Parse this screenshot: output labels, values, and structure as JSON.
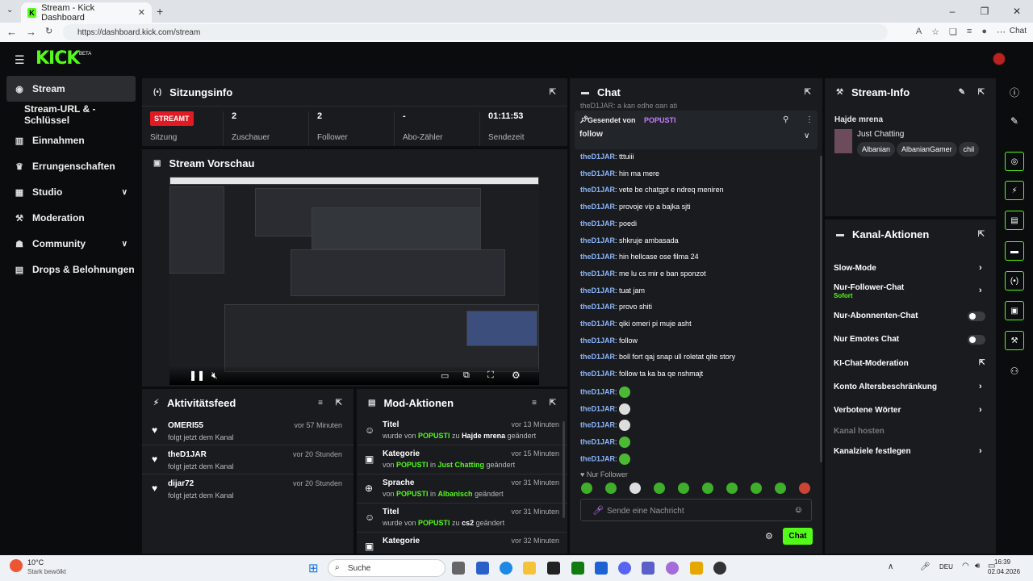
{
  "browser": {
    "tab_title": "Stream - Kick Dashboard",
    "url": "https://dashboard.kick.com/stream",
    "chat_label": "Chat"
  },
  "app": {
    "logo": "KICK",
    "beta": "BETA"
  },
  "sidebar": {
    "items": [
      {
        "label": "Stream",
        "icon": "stream-icon"
      },
      {
        "label": "Stream-URL & -Schlüssel"
      },
      {
        "label": "Einnahmen",
        "icon": "chart-icon"
      },
      {
        "label": "Errungenschaften",
        "icon": "trophy-icon"
      },
      {
        "label": "Studio",
        "icon": "studio-icon"
      },
      {
        "label": "Moderation",
        "icon": "wrench-icon"
      },
      {
        "label": "Community",
        "icon": "community-icon"
      },
      {
        "label": "Drops & Belohnungen",
        "icon": "drops-icon"
      }
    ]
  },
  "session": {
    "title": "Sitzungsinfo",
    "badge": "STREAMT",
    "badge_label": "Sitzung",
    "stats": [
      {
        "value": "2",
        "label": "Zuschauer"
      },
      {
        "value": "2",
        "label": "Follower"
      },
      {
        "value": "-",
        "label": "Abo-Zähler"
      },
      {
        "value": "01:11:53",
        "label": "Sendezeit"
      }
    ]
  },
  "preview": {
    "title": "Stream Vorschau"
  },
  "activity": {
    "title": "Aktivitätsfeed",
    "items": [
      {
        "name": "OMERI55",
        "sub": "folgt jetzt dem Kanal",
        "time": "vor 57 Minuten"
      },
      {
        "name": "theD1JAR",
        "sub": "folgt jetzt dem Kanal",
        "time": "vor 20 Stunden"
      },
      {
        "name": "dijar72",
        "sub": "folgt jetzt dem Kanal",
        "time": "vor 20 Stunden"
      }
    ]
  },
  "mod": {
    "title": "Mod-Aktionen",
    "items": [
      {
        "title": "Titel",
        "time": "vor 13 Minuten",
        "p1": "wurde von ",
        "who": "POPUSTI",
        "p2": " zu ",
        "what": "Hajde mrena",
        "p3": " geändert",
        "what_color": "w"
      },
      {
        "title": "Kategorie",
        "time": "vor 15 Minuten",
        "p1": "von ",
        "who": "POPUSTI",
        "p2": " in ",
        "what": "Just Chatting",
        "p3": " geändert",
        "what_color": "g"
      },
      {
        "title": "Sprache",
        "time": "vor 31 Minuten",
        "p1": "von ",
        "who": "POPUSTI",
        "p2": " in ",
        "what": "Albanisch",
        "p3": " geändert",
        "what_color": "g"
      },
      {
        "title": "Titel",
        "time": "vor 31 Minuten",
        "p1": "wurde von ",
        "who": "POPUSTI",
        "p2": " zu ",
        "what": "cs2",
        "p3": " geändert",
        "what_color": "w"
      },
      {
        "title": "Kategorie",
        "time": "vor 32 Minuten",
        "p1": "",
        "who": "",
        "p2": "",
        "what": "",
        "p3": "",
        "what_color": "w"
      }
    ]
  },
  "chat": {
    "title": "Chat",
    "partial_top": "theD1JAR: a kan edhe qan atj",
    "pinned_by": "Gesendet von",
    "pinned_user": "POPUSTI",
    "pinned_msg": "follow",
    "messages": [
      {
        "user": "theD1JAR",
        "text": "tttuiii"
      },
      {
        "user": "theD1JAR",
        "text": "hin ma mere"
      },
      {
        "user": "theD1JAR",
        "text": "vete be chatgpt e ndreq meniren"
      },
      {
        "user": "theD1JAR",
        "text": "provoje vip a bajka sjti"
      },
      {
        "user": "theD1JAR",
        "text": "poedi"
      },
      {
        "user": "theD1JAR",
        "text": "shkruje ambasada"
      },
      {
        "user": "theD1JAR",
        "text": "hin hellcase ose filma 24"
      },
      {
        "user": "theD1JAR",
        "text": "me lu cs mir e ban sponzot"
      },
      {
        "user": "theD1JAR",
        "text": "tuat jam"
      },
      {
        "user": "theD1JAR",
        "text": "provo shiti"
      },
      {
        "user": "theD1JAR",
        "text": "qiki omeri pi muje asht"
      },
      {
        "user": "theD1JAR",
        "text": "follow"
      },
      {
        "user": "theD1JAR",
        "text": "boll fort qaj snap ull roletat qite story"
      },
      {
        "user": "theD1JAR",
        "text": "follow ta ka ba qe nshmajt"
      },
      {
        "user": "theD1JAR",
        "text": "",
        "emote": "green"
      },
      {
        "user": "theD1JAR",
        "text": "",
        "emote": "gray"
      },
      {
        "user": "theD1JAR",
        "text": "",
        "emote": "gray"
      },
      {
        "user": "theD1JAR",
        "text": "",
        "emote": "green"
      },
      {
        "user": "theD1JAR",
        "text": "",
        "emote": "green"
      }
    ],
    "mode": "Nur Follower",
    "placeholder": "Sende eine Nachricht",
    "send": "Chat"
  },
  "stream_info": {
    "title": "Stream-Info",
    "stream_title": "Hajde mrena",
    "category": "Just Chatting",
    "tags": [
      "Albanian",
      "AlbanianGamer",
      "chil"
    ]
  },
  "actions": {
    "title": "Kanal-Aktionen",
    "items": [
      {
        "label": "Slow-Mode",
        "control": "chevron"
      },
      {
        "label": "Nur-Follower-Chat",
        "sub": "Sofort",
        "control": "chevron"
      },
      {
        "label": "Nur-Abonnenten-Chat",
        "control": "toggle"
      },
      {
        "label": "Nur Emotes Chat",
        "control": "toggle"
      },
      {
        "label": "KI-Chat-Moderation",
        "control": "external"
      },
      {
        "label": "Konto Altersbeschränkung",
        "control": "chevron"
      },
      {
        "label": "Verbotene Wörter",
        "control": "chevron"
      },
      {
        "label": "Kanal hosten",
        "control": "none",
        "disabled": true
      },
      {
        "label": "Kanalziele festlegen",
        "control": "chevron"
      }
    ]
  },
  "taskbar": {
    "weather_temp": "10°C",
    "weather_desc": "Stark bewölkt",
    "search": "Suche",
    "lang": "DEU",
    "time": "16:39",
    "date": "02.04.2026"
  },
  "colors": {
    "accent": "#53fc18",
    "live": "#e01b24",
    "panel": "#191b1f"
  }
}
